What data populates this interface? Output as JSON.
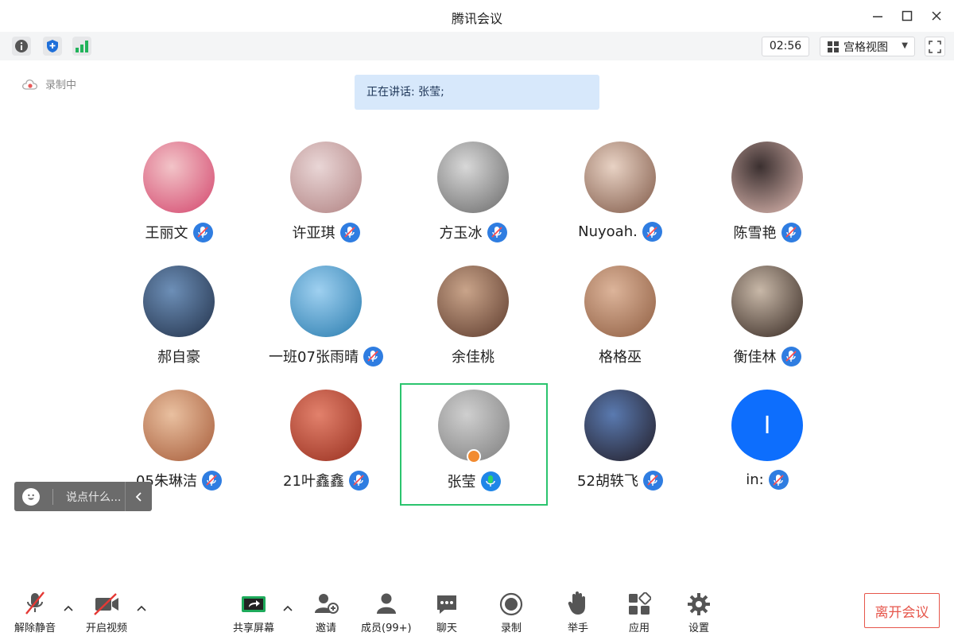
{
  "window": {
    "title": "腾讯会议"
  },
  "toolbar": {
    "timer": "02:56",
    "view_mode": "宫格视图"
  },
  "recording": {
    "label": "录制中"
  },
  "speaker_banner": {
    "text": "正在讲话: 张莹;"
  },
  "participants": [
    {
      "name": "王丽文",
      "muted": true
    },
    {
      "name": "许亚琪",
      "muted": true
    },
    {
      "name": "方玉冰",
      "muted": true
    },
    {
      "name": "Nuyoah.",
      "muted": true
    },
    {
      "name": "陈雪艳",
      "muted": true
    },
    {
      "name": "郝自豪",
      "muted": null
    },
    {
      "name": "一班07张雨晴",
      "muted": true
    },
    {
      "name": "余佳桃",
      "muted": null
    },
    {
      "name": "格格巫",
      "muted": null
    },
    {
      "name": "衡佳林",
      "muted": true
    },
    {
      "name": "05朱琳洁",
      "muted": true
    },
    {
      "name": "21叶鑫鑫",
      "muted": true
    },
    {
      "name": "张莹",
      "muted": false,
      "speaking": true
    },
    {
      "name": "52胡轶飞",
      "muted": true
    },
    {
      "name": "in:",
      "muted": true,
      "initial": "I"
    }
  ],
  "chat": {
    "placeholder": "说点什么..."
  },
  "bottombar": {
    "unmute": "解除静音",
    "start_video": "开启视频",
    "share_screen": "共享屏幕",
    "invite": "邀请",
    "members": "成员(99+)",
    "chat": "聊天",
    "record": "录制",
    "raise_hand": "举手",
    "apps": "应用",
    "settings": "设置",
    "leave": "离开会议"
  },
  "colors": {
    "accent_blue": "#2f7de1",
    "speaker_banner_bg": "#d7e8fb",
    "active_border": "#2bc46e",
    "leave_red": "#e6564b"
  }
}
